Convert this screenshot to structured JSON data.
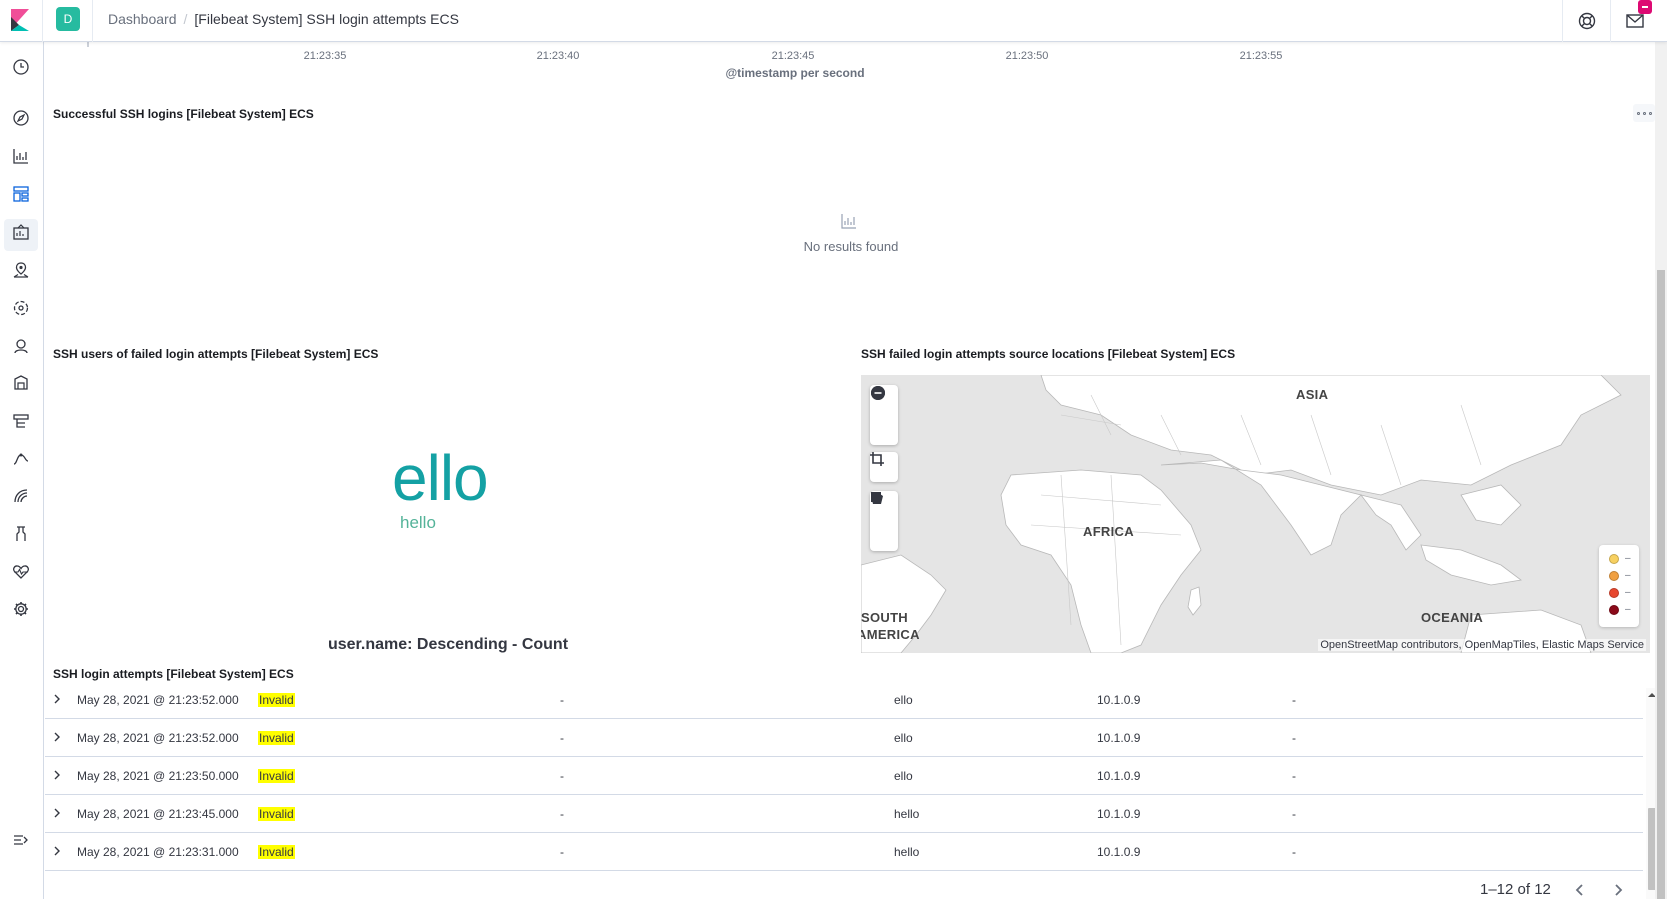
{
  "header": {
    "space_initial": "D",
    "breadcrumb_root": "Dashboard",
    "breadcrumb_separator": "/",
    "breadcrumb_current": "[Filebeat System] SSH login attempts ECS"
  },
  "sidebar": {
    "items": [
      "clock-icon",
      "compass-icon",
      "visualize-icon",
      "dashboard-icon",
      "canvas-icon",
      "maps-icon",
      "ml-icon",
      "graph-icon",
      "observability-icon",
      "logs-icon",
      "apm-icon",
      "uptime-icon",
      "dev-tools-icon",
      "monitoring-icon",
      "management-icon",
      "collapse-icon"
    ]
  },
  "timeline_axis": {
    "ticks": [
      "21:23:35",
      "21:23:40",
      "21:23:45",
      "21:23:50",
      "21:23:55"
    ],
    "title": "@timestamp per second"
  },
  "panels": {
    "successful_logins": {
      "title": "Successful SSH logins [Filebeat System] ECS",
      "empty_text": "No results found"
    },
    "failed_users": {
      "title": "SSH users of failed login attempts [Filebeat System] ECS",
      "tag_large": "ello",
      "tag_small": "hello",
      "footer": "user.name: Descending - Count"
    },
    "failed_locations": {
      "title": "SSH failed login attempts source locations [Filebeat System] ECS",
      "labels": [
        "ASIA",
        "AFRICA",
        "SOUTH",
        "AMERICA",
        "OCEANIA"
      ],
      "legend_colors": [
        "#f7d060",
        "#f0a042",
        "#e7472f",
        "#8b0a1a"
      ],
      "legend_value": "–",
      "attribution": "OpenStreetMap contributors, OpenMapTiles, Elastic Maps Service"
    },
    "login_attempts": {
      "title": "SSH login attempts [Filebeat System] ECS",
      "rows": [
        {
          "time": "May 28, 2021 @ 21:23:52.000",
          "status": "Invalid",
          "col3": "-",
          "user": "ello",
          "ip": "10.1.0.9",
          "col6": "-"
        },
        {
          "time": "May 28, 2021 @ 21:23:52.000",
          "status": "Invalid",
          "col3": "-",
          "user": "ello",
          "ip": "10.1.0.9",
          "col6": "-"
        },
        {
          "time": "May 28, 2021 @ 21:23:50.000",
          "status": "Invalid",
          "col3": "-",
          "user": "ello",
          "ip": "10.1.0.9",
          "col6": "-"
        },
        {
          "time": "May 28, 2021 @ 21:23:45.000",
          "status": "Invalid",
          "col3": "-",
          "user": "hello",
          "ip": "10.1.0.9",
          "col6": "-"
        },
        {
          "time": "May 28, 2021 @ 21:23:31.000",
          "status": "Invalid",
          "col3": "-",
          "user": "hello",
          "ip": "10.1.0.9",
          "col6": "-"
        }
      ],
      "pagination": "1–12 of 12"
    }
  }
}
